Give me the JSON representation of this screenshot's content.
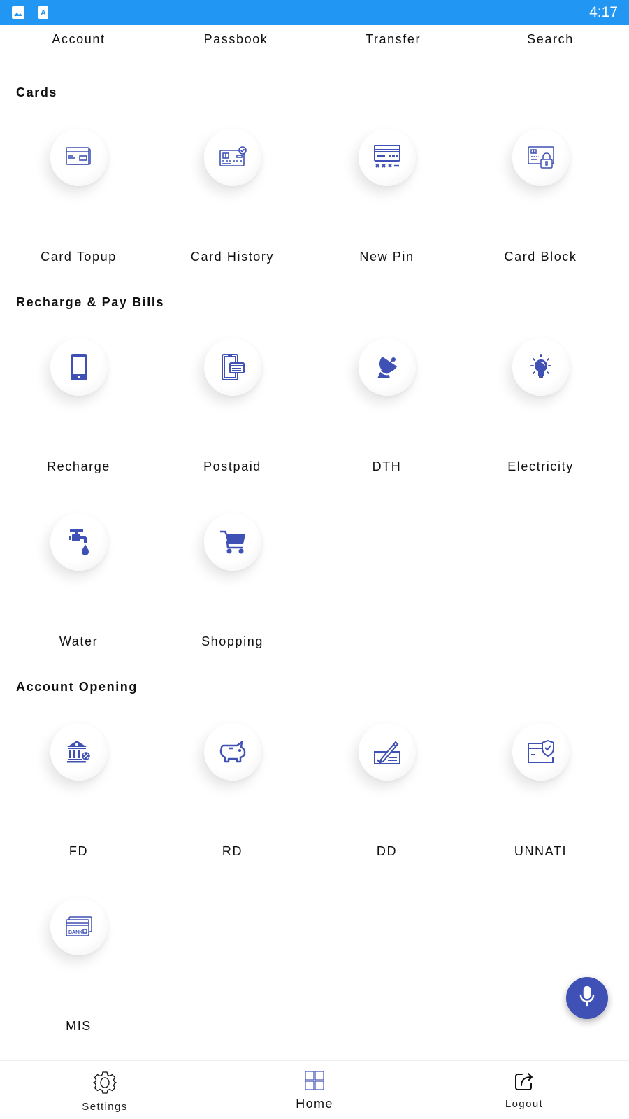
{
  "status_bar": {
    "time": "4:17",
    "icons": [
      "gallery-notification-icon",
      "text-notification-icon"
    ],
    "color": "#2196f3"
  },
  "top_row": {
    "labels": [
      "Account",
      "Passbook",
      "Transfer",
      "Search"
    ]
  },
  "sections": [
    {
      "title": "Cards",
      "items": [
        {
          "label": "Card Topup",
          "icon": "card-topup-icon"
        },
        {
          "label": "Card History",
          "icon": "card-history-icon"
        },
        {
          "label": "New Pin",
          "icon": "new-pin-icon"
        },
        {
          "label": "Card Block",
          "icon": "card-block-icon"
        }
      ]
    },
    {
      "title": "Recharge & Pay Bills",
      "items": [
        {
          "label": "Recharge",
          "icon": "mobile-phone-icon"
        },
        {
          "label": "Postpaid",
          "icon": "postpaid-bill-icon"
        },
        {
          "label": "DTH",
          "icon": "satellite-dish-icon"
        },
        {
          "label": "Electricity",
          "icon": "light-bulb-icon"
        },
        {
          "label": "Water",
          "icon": "water-tap-icon"
        },
        {
          "label": "Shopping",
          "icon": "shopping-cart-icon"
        }
      ]
    },
    {
      "title": "Account Opening",
      "items": [
        {
          "label": "FD",
          "icon": "bank-percent-icon"
        },
        {
          "label": "RD",
          "icon": "piggy-bank-icon"
        },
        {
          "label": "DD",
          "icon": "cheque-sign-icon"
        },
        {
          "label": "UNNATI",
          "icon": "secure-card-icon"
        },
        {
          "label": "MIS",
          "icon": "bank-cards-icon"
        }
      ]
    }
  ],
  "fab": {
    "icon": "microphone-icon",
    "color": "#3f51b5"
  },
  "bottom_nav": {
    "items": [
      {
        "label": "Settings",
        "icon": "gear-icon",
        "active": false
      },
      {
        "label": "Home",
        "icon": "grid-home-icon",
        "active": true
      },
      {
        "label": "Logout",
        "icon": "logout-share-icon",
        "active": false
      }
    ]
  },
  "accent_color": "#3f51b5"
}
